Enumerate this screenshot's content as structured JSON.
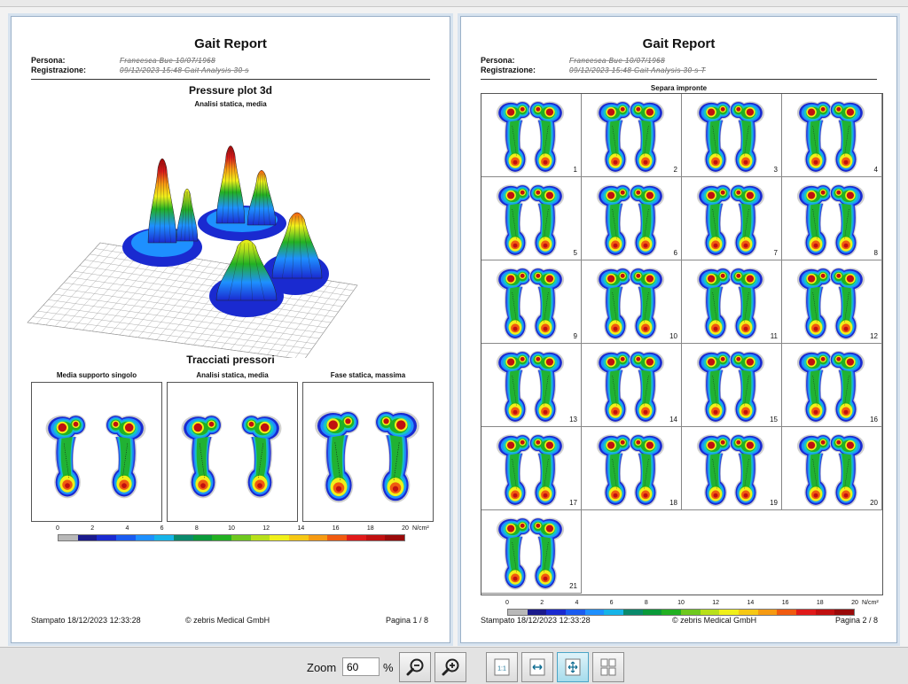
{
  "report": {
    "title": "Gait Report",
    "persona_label": "Persona:",
    "persona_value": "Francesca Bue 10/07/1968",
    "registrazione_label": "Registrazione:",
    "registrazione_value": "09/12/2023 15:48 Gait Analysis 30 s",
    "registrazione_value_p2": "09/12/2023 15:48 Gait Analysis 30 s T"
  },
  "page1": {
    "plot3d_title": "Pressure plot 3d",
    "plot3d_subtitle": "Analisi statica, media",
    "tracciati_title": "Tracciati pressori",
    "panels": [
      {
        "title": "Media supporto singolo"
      },
      {
        "title": "Analisi statica, media"
      },
      {
        "title": "Fase statica, massima"
      }
    ],
    "footer_printed": "Stampato  18/12/2023 12:33:28",
    "footer_company": "© zebris Medical GmbH",
    "footer_page": "Pagina   1 / 8"
  },
  "page2": {
    "section_title": "Separa impronte",
    "footprints": [
      "1",
      "2",
      "3",
      "4",
      "5",
      "6",
      "7",
      "8",
      "9",
      "10",
      "11",
      "12",
      "13",
      "14",
      "15",
      "16",
      "17",
      "18",
      "19",
      "20",
      "21"
    ],
    "footer_printed": "Stampato  18/12/2023 12:33:28",
    "footer_company": "© zebris Medical GmbH",
    "footer_page": "Pagina   2 / 8"
  },
  "scale": {
    "ticks": [
      "0",
      "2",
      "4",
      "6",
      "8",
      "10",
      "12",
      "14",
      "16",
      "18",
      "20"
    ],
    "unit": "N/cm²",
    "colors": [
      "#b8b8b8",
      "#1a1a8c",
      "#1a2ad0",
      "#1a5bf0",
      "#1e90ff",
      "#16b4e8",
      "#0a8a6c",
      "#0a9a3a",
      "#22b022",
      "#6ec81e",
      "#b8e01a",
      "#f0f01a",
      "#f6c814",
      "#f69a12",
      "#f05a10",
      "#e01a1a",
      "#c01010",
      "#9a0a0a"
    ]
  },
  "toolbar": {
    "zoom_label": "Zoom",
    "zoom_value": "60",
    "zoom_unit": "%",
    "buttons": {
      "zoom_out": "zoom-out",
      "zoom_in": "zoom-in",
      "actual_size": "1:1",
      "fit_width": "fit-width",
      "fit_page": "fit-page",
      "multi_page": "multi-page"
    }
  }
}
